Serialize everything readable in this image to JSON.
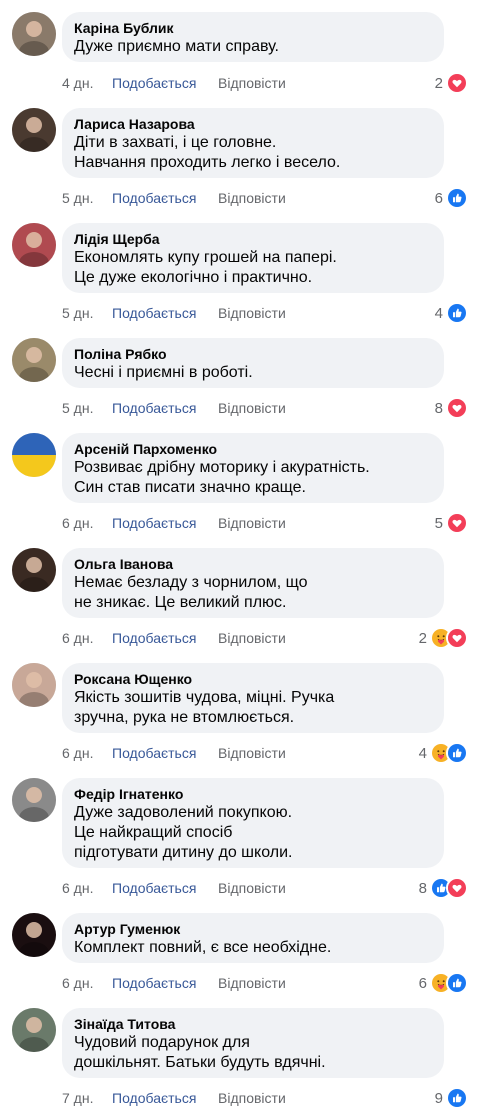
{
  "labels": {
    "like": "Подобається",
    "reply": "Відповісти"
  },
  "colors": {
    "bubble": "#f0f2f5",
    "link": "#385898",
    "meta": "#65676b",
    "heart": "#f33e58",
    "thumb": "#1877f2",
    "care": "#f7b125"
  },
  "comments": [
    {
      "author": "Каріна Бублик",
      "text": "Дуже приємно мати справу.",
      "time": "4 дн.",
      "count": "2",
      "reactions": [
        "heart-icon"
      ],
      "avatar": "#8a7a6a"
    },
    {
      "author": "Лариса Назарова",
      "text": "Діти в захваті, і це головне.\nНавчання проходить легко і весело.",
      "time": "5 дн.",
      "count": "6",
      "reactions": [
        "like-icon"
      ],
      "avatar": "#4a3a30"
    },
    {
      "author": "Лідія Щерба",
      "text": "Економлять купу грошей на папері.\nЦе дуже екологічно і практично.",
      "time": "5 дн.",
      "count": "4",
      "reactions": [
        "like-icon"
      ],
      "avatar": "#b04a50"
    },
    {
      "author": "Поліна Рябко",
      "text": "Чесні і приємні в роботі.",
      "time": "5 дн.",
      "count": "8",
      "reactions": [
        "heart-icon"
      ],
      "avatar": "#9a8a6a"
    },
    {
      "author": "Арсеній Пархоменко",
      "text": "Розвиває дрібну моторику і акуратність.\nСин став писати значно краще.",
      "time": "6 дн.",
      "count": "5",
      "reactions": [
        "heart-icon"
      ],
      "avatar": "flag"
    },
    {
      "author": "Ольга Іванова",
      "text": "Немає безладу з чорнилом, що\nне зникає. Це великий плюс.",
      "time": "6 дн.",
      "count": "2",
      "reactions": [
        "care-icon",
        "heart-icon"
      ],
      "avatar": "#3a2a22"
    },
    {
      "author": "Роксана Ющенко",
      "text": "Якість зошитів чудова, міцні. Ручка\nзручна, рука не втомлюється.",
      "time": "6 дн.",
      "count": "4",
      "reactions": [
        "care-icon",
        "like-icon"
      ],
      "avatar": "#c8a898"
    },
    {
      "author": "Федір Ігнатенко",
      "text": "Дуже задоволений покупкою.\nЦе найкращий спосіб\nпідготувати дитину до школи.",
      "time": "6 дн.",
      "count": "8",
      "reactions": [
        "like-icon",
        "heart-icon"
      ],
      "avatar": "#8a8a8a"
    },
    {
      "author": "Артур Гуменюк",
      "text": "Комплект повний, є все необхідне.",
      "time": "6 дн.",
      "count": "6",
      "reactions": [
        "care-icon",
        "like-icon"
      ],
      "avatar": "#1a0e10"
    },
    {
      "author": "Зінаїда Титова",
      "text": "Чудовий подарунок для\nдошкільнят. Батьки будуть вдячні.",
      "time": "7 дн.",
      "count": "9",
      "reactions": [
        "like-icon"
      ],
      "avatar": "#6a7a6a"
    }
  ]
}
